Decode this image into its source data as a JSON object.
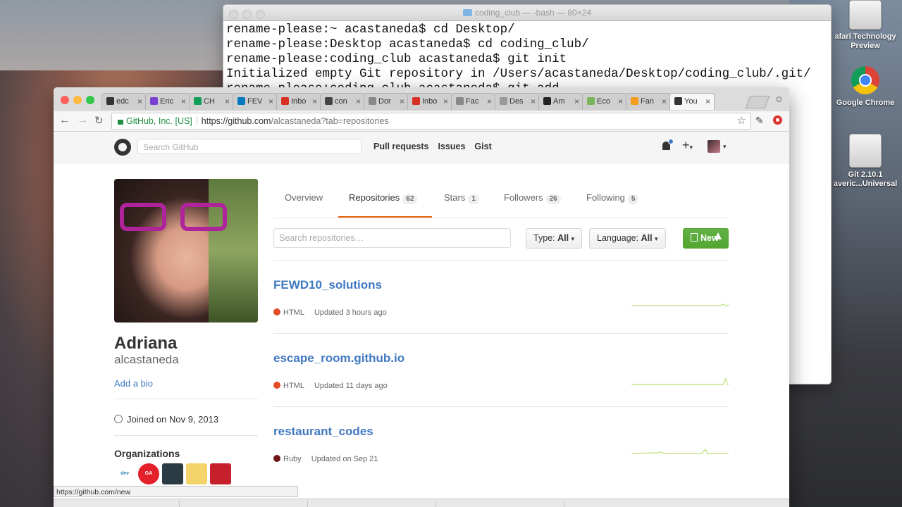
{
  "desktop": {
    "icons": [
      {
        "name": "safari-tp-drive-icon",
        "label_lines": [
          "afari Technology",
          "Preview"
        ]
      },
      {
        "name": "chrome-app-icon",
        "label_lines": [
          "Google Chrome"
        ]
      },
      {
        "name": "git-drive-icon",
        "label_lines": [
          "Git 2.10.1",
          "averic...Universal"
        ]
      }
    ]
  },
  "terminal": {
    "title": "coding_club — -bash — 80×24",
    "lines": [
      "rename-please:~ acastaneda$ cd Desktop/",
      "rename-please:Desktop acastaneda$ cd coding_club/",
      "rename-please:coding_club acastaneda$ git init",
      "Initialized empty Git repository in /Users/acastaneda/Desktop/coding_club/.git/",
      "rename-please:coding_club acastaneda$ git add ."
    ]
  },
  "browser": {
    "tabs": [
      {
        "label": "edc",
        "color": "#333"
      },
      {
        "label": "Eric",
        "color": "#7b3fd1"
      },
      {
        "label": "CH",
        "color": "#0f9d58"
      },
      {
        "label": "FEV",
        "color": "#0079bf"
      },
      {
        "label": "Inbo",
        "color": "#d93025"
      },
      {
        "label": "con",
        "color": "#444"
      },
      {
        "label": "Dor",
        "color": "#888"
      },
      {
        "label": "Inbo",
        "color": "#d93025"
      },
      {
        "label": "Fac",
        "color": "#888"
      },
      {
        "label": "Des",
        "color": "#999"
      },
      {
        "label": "Am",
        "color": "#222"
      },
      {
        "label": "Eco",
        "color": "#7ab55c"
      },
      {
        "label": "Fan",
        "color": "#f29d1c"
      },
      {
        "label": "You",
        "color": "#333"
      }
    ],
    "ev_label": "GitHub, Inc. [US]",
    "url_host": "https://github.com",
    "url_path": "/alcastaneda?tab=repositories",
    "status_url": "https://github.com/new"
  },
  "github": {
    "search_placeholder": "Search GitHub",
    "nav": [
      "Pull requests",
      "Issues",
      "Gist"
    ],
    "plus": "+",
    "profile": {
      "fullname": "Adriana",
      "username": "alcastaneda",
      "add_bio": "Add a bio",
      "joined": "Joined on Nov 9, 2013",
      "orgs_title": "Organizations",
      "orgs": [
        {
          "text": "dev",
          "color": "#fff",
          "fg": "#2f7fb5"
        },
        {
          "text": "GA",
          "color": "#e4202a",
          "fg": "#fff"
        },
        {
          "text": "",
          "color": "#2b3b44",
          "fg": "#fff"
        },
        {
          "text": "",
          "color": "#f4d46a",
          "fg": "#336"
        },
        {
          "text": "",
          "color": "#c7202d",
          "fg": "#fff"
        }
      ]
    },
    "tabs": [
      {
        "label": "Overview",
        "count": null
      },
      {
        "label": "Repositories",
        "count": "62"
      },
      {
        "label": "Stars",
        "count": "1"
      },
      {
        "label": "Followers",
        "count": "26"
      },
      {
        "label": "Following",
        "count": "5"
      }
    ],
    "repo_search_placeholder": "Search repositories…",
    "type_label": "Type:",
    "type_value": "All",
    "language_label": "Language:",
    "language_value": "All",
    "new_button": "New",
    "repos": [
      {
        "name": "FEWD10_solutions",
        "language": "HTML",
        "lang_color": "#e34c26",
        "updated": "Updated 3 hours ago"
      },
      {
        "name": "escape_room.github.io",
        "language": "HTML",
        "lang_color": "#e34c26",
        "updated": "Updated 11 days ago"
      },
      {
        "name": "restaurant_codes",
        "language": "Ruby",
        "lang_color": "#701516",
        "updated": "Updated on Sep 21"
      }
    ]
  }
}
